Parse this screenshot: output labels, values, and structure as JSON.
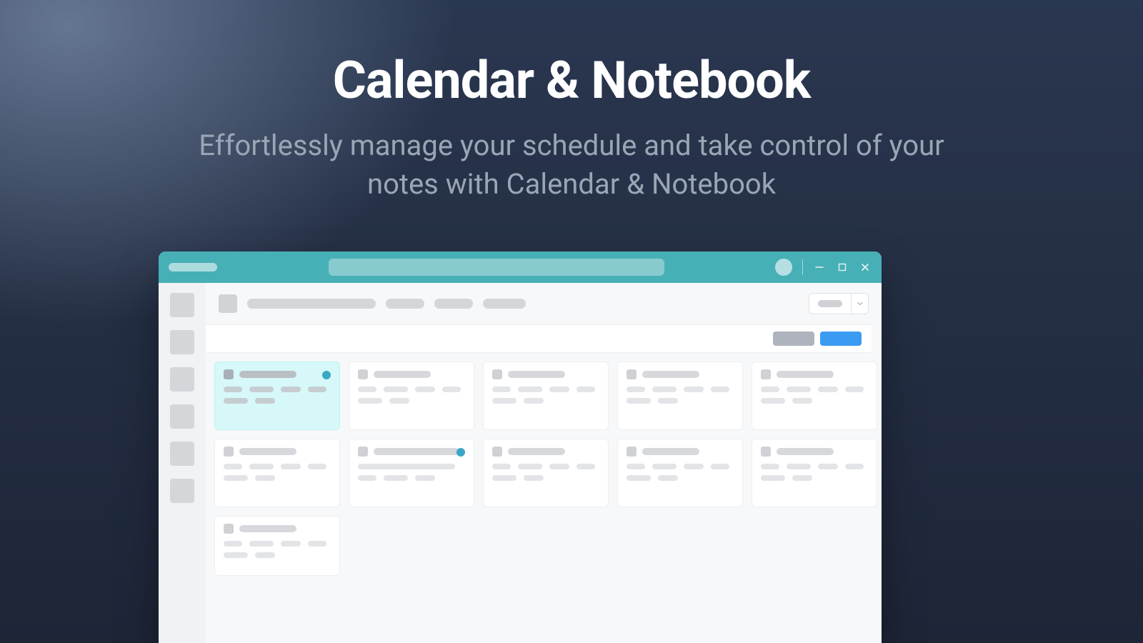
{
  "hero": {
    "title": "Calendar & Notebook",
    "subtitle": "Effortlessly manage your schedule and take control of your notes with Calendar & Notebook"
  },
  "window": {
    "titlebar": {
      "brand_placeholder": "",
      "search_placeholder": "",
      "controls": {
        "minimize": "minimize",
        "maximize": "maximize",
        "close": "close"
      }
    }
  },
  "colors": {
    "accent_teal": "#47b0b6",
    "highlight": "#d6f8f9",
    "dot": "#3aa7c6",
    "chip_blue": "#3b9af2",
    "chip_gray": "#aeb3bd"
  },
  "sidebar": {
    "item_count": 6
  },
  "filter": {
    "chips": [
      "gray",
      "blue"
    ]
  },
  "grid": {
    "rows": [
      [
        {
          "highlight": true,
          "dot": true
        },
        {
          "highlight": false
        },
        {
          "highlight": false
        },
        {
          "highlight": false
        },
        {
          "highlight": false
        }
      ],
      [
        {
          "highlight": false
        },
        {
          "highlight": false,
          "dot": true,
          "wide": true
        },
        {
          "highlight": false
        },
        {
          "highlight": false
        },
        {
          "highlight": false
        }
      ],
      [
        {
          "highlight": false
        }
      ]
    ]
  }
}
